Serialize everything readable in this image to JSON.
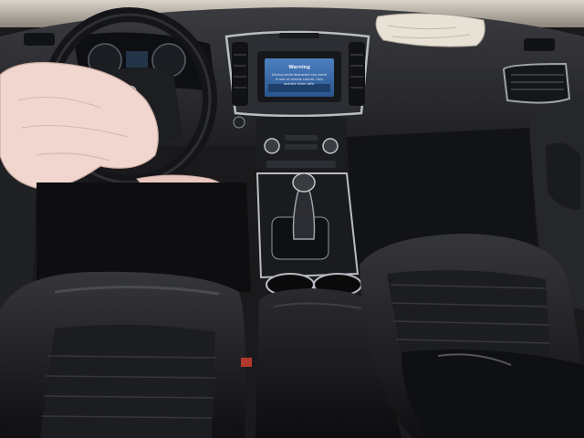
{
  "scene": {
    "colors": {
      "leather": "#141416",
      "leather_highlight": "#3a3b40",
      "dash": "#2b2c30",
      "trim_silver": "#b9bcc1",
      "airbag_fabric": "#f0d6cf",
      "screen_blue": "#2f5f9a"
    }
  },
  "infotainment": {
    "screen_title": "Warning",
    "screen_message": "Driving while distracted can result in loss of vehicle control. Only operate when safe."
  },
  "icons": {
    "steering_logo": "ford-oval-icon",
    "gear_shifter": "gear-shifter-icon",
    "air_vent": "air-vent-icon"
  }
}
